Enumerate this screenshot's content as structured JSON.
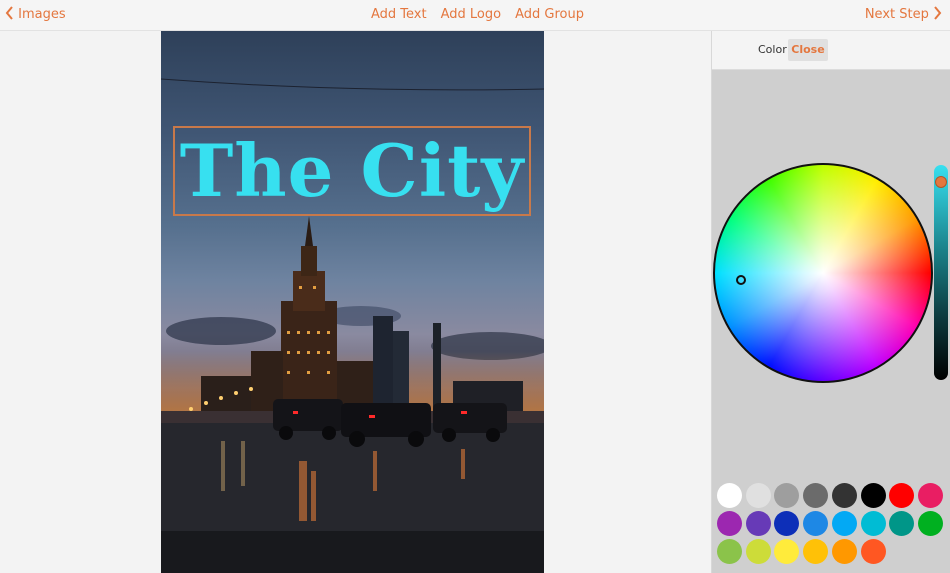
{
  "topbar": {
    "back_label": "Images",
    "menu": [
      "Add Text",
      "Add Logo",
      "Add Group"
    ],
    "next_label": "Next Step"
  },
  "canvas": {
    "title_text": "The City",
    "title_color": "#37e0f0"
  },
  "panel": {
    "tab_label": "Color",
    "close_label": "Close",
    "swatches": [
      "#ffffff",
      "#e0e0e0",
      "#9e9e9e",
      "#6b6b6b",
      "#333333",
      "#000000",
      "#ff0000",
      "#e91e63",
      "#9c27b0",
      "#673ab7",
      "#0d2fb8",
      "#1e88e5",
      "#03a9f4",
      "#00bcd4",
      "#009688",
      "#00b020",
      "#8bc34a",
      "#cddc39",
      "#ffeb3b",
      "#ffc107",
      "#ff9800",
      "#ff5722"
    ]
  },
  "icons": [
    "chevron-left-icon",
    "chevron-right-icon"
  ]
}
